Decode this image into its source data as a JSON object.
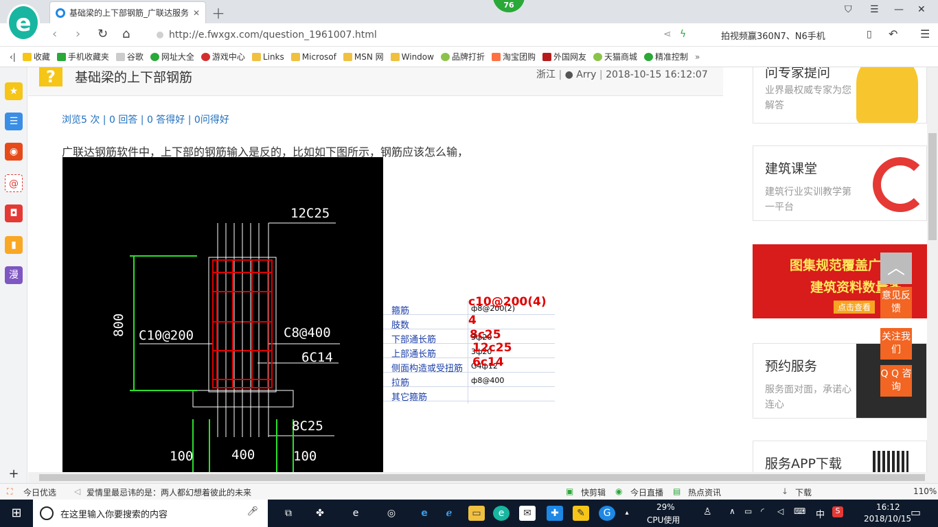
{
  "browser": {
    "tab_title": "基础梁的上下部钢筋_广联达服务",
    "badge_count": "76",
    "url": "http://e.fwxgx.com/question_1961007.html",
    "search_text": "拍视频赢360N7、N6手机",
    "bookmarks": [
      "收藏",
      "手机收藏夹",
      "谷歌",
      "网址大全",
      "游戏中心",
      "Links",
      "Microsof",
      "MSN 网",
      "Window",
      "品牌打折",
      "淘宝团购",
      "外国网友",
      "天猫商城",
      "精准控制"
    ],
    "zoom": "110%"
  },
  "question": {
    "title": "基础梁的上下部钢筋",
    "location": "浙江",
    "author": "Arry",
    "datetime": "2018-10-15 16:12:07",
    "stats": "浏览5 次 | 0 回答 | 0 答得好 | 0问得好",
    "description": "广联达钢筋软件中，上下部的钢筋输入是反的，比如如下图所示，钢筋应该怎么输，"
  },
  "drawing": {
    "top_label": "12C25",
    "left_stirrup": "C10@200",
    "right_tie": "C8@400",
    "side_bars": "6C14",
    "bottom_label": "8C25",
    "height_dim": "800",
    "dim_left": "100",
    "dim_mid": "400",
    "dim_right": "100"
  },
  "rebar_table": {
    "rows": [
      {
        "label": "箍筋",
        "value": "ф8@200(2)",
        "answer": "c10@200(4)"
      },
      {
        "label": "肢数",
        "value": "",
        "answer": "4"
      },
      {
        "label": "下部通长筋",
        "value": "3ф20",
        "answer": "8c25"
      },
      {
        "label": "上部通长筋",
        "value": "3ф20",
        "answer": "12c25"
      },
      {
        "label": "侧面构造或受扭筋",
        "value": "G4ф12",
        "answer": "6c14"
      },
      {
        "label": "拉筋",
        "value": "ф8@400",
        "answer": ""
      },
      {
        "label": "其它箍筋",
        "value": "",
        "answer": ""
      }
    ]
  },
  "sidebar_cards": [
    {
      "title": "问专家提问",
      "subtitle": "业界最权威专家为您解答"
    },
    {
      "title": "建筑课堂",
      "subtitle": "建筑行业实训教学第一平台"
    },
    {
      "title": "预约服务",
      "subtitle": "服务面对面，承诺心连心"
    },
    {
      "title": "服务APP下载",
      "subtitle": ""
    }
  ],
  "promo": {
    "line1": "图集规范覆盖广",
    "line2": "建筑资料数量多",
    "button": "点击查看"
  },
  "float_buttons": {
    "feedback": "意见反馈",
    "follow": "关注我们",
    "qq": "Q Q 咨询"
  },
  "statusbar": {
    "left1": "今日优选",
    "news": "爱情里最忌讳的是：两人都幻想着彼此的未来",
    "r1": "快剪辑",
    "r2": "今日直播",
    "r3": "热点资讯",
    "r4": "下载"
  },
  "taskbar": {
    "search_placeholder": "在这里输入你要搜索的内容",
    "cpu": "29%",
    "cpu_label": "CPU使用",
    "ime": "中",
    "time": "16:12",
    "date": "2018/10/15"
  }
}
